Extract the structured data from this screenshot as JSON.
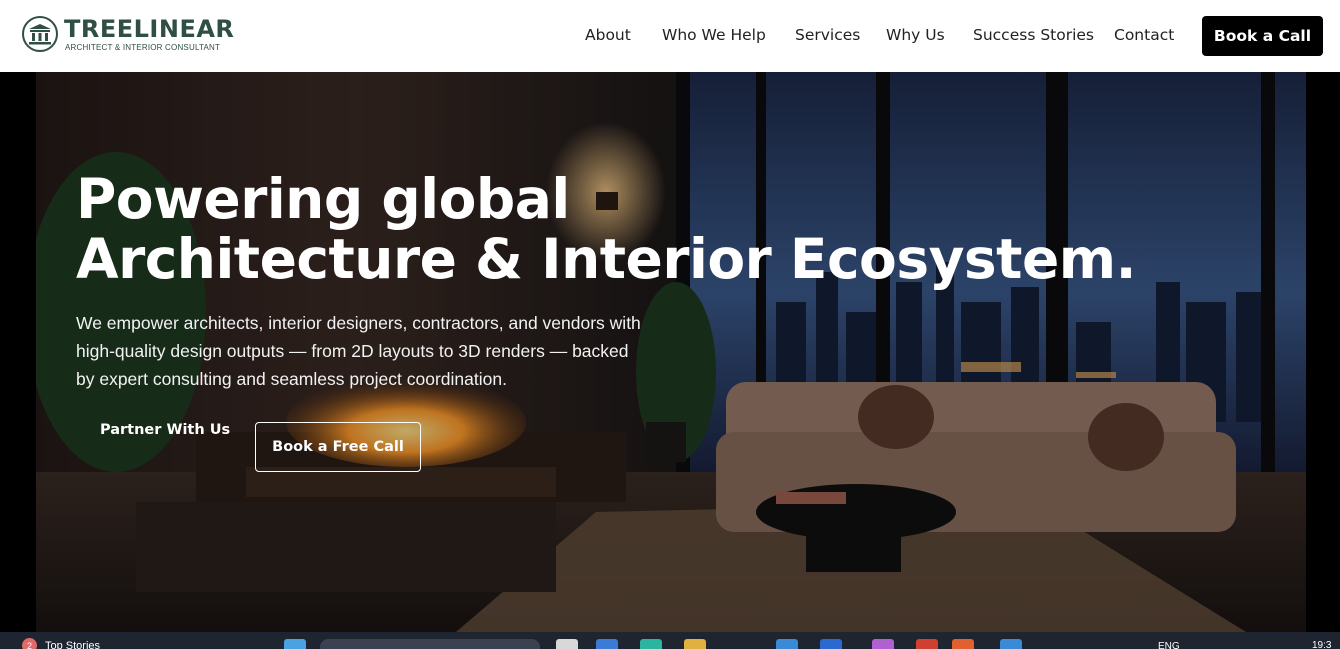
{
  "brand": {
    "name": "TREELINEAR",
    "tagline": "ARCHITECT & INTERIOR CONSULTANT",
    "color": "#2f4f45"
  },
  "nav": {
    "items": [
      {
        "label": "About"
      },
      {
        "label": "Who We Help"
      },
      {
        "label": "Services"
      },
      {
        "label": "Why Us"
      },
      {
        "label": "Success Stories"
      },
      {
        "label": "Contact"
      }
    ],
    "cta_label": "Book a Call"
  },
  "hero": {
    "headline_line1": "Powering global",
    "headline_line2": "Architecture & Interior Ecosystem.",
    "subtext": "We empower architects, interior designers, contractors, and vendors with high-quality design outputs — from 2D layouts to 3D renders — backed by expert consulting and seamless project coordination.",
    "primary_cta": "Partner With Us",
    "secondary_cta": "Book a Free Call",
    "image_icon": "luxury-living-room-city-view-image"
  },
  "taskbar": {
    "news_badge": "2",
    "news_label": "Top Stories",
    "language": "ENG",
    "time": "19:3"
  }
}
